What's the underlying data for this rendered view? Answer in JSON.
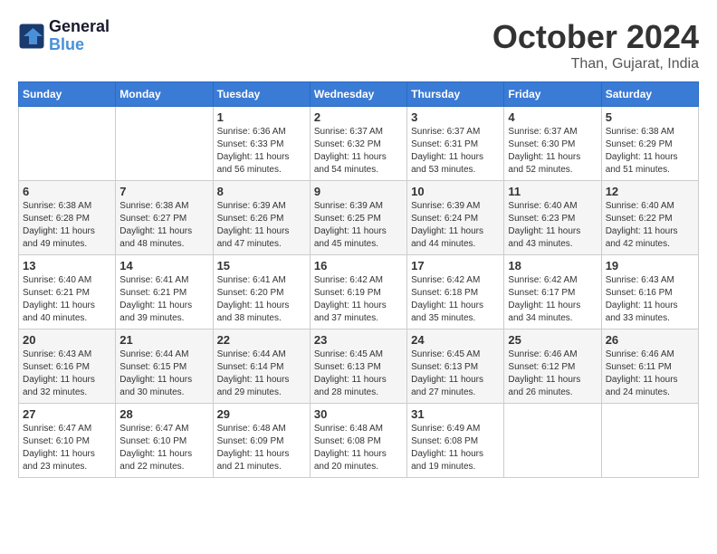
{
  "logo": {
    "line1": "General",
    "line2": "Blue"
  },
  "title": "October 2024",
  "location": "Than, Gujarat, India",
  "days_header": [
    "Sunday",
    "Monday",
    "Tuesday",
    "Wednesday",
    "Thursday",
    "Friday",
    "Saturday"
  ],
  "weeks": [
    [
      {
        "day": "",
        "sunrise": "",
        "sunset": "",
        "daylight": ""
      },
      {
        "day": "",
        "sunrise": "",
        "sunset": "",
        "daylight": ""
      },
      {
        "day": "1",
        "sunrise": "Sunrise: 6:36 AM",
        "sunset": "Sunset: 6:33 PM",
        "daylight": "Daylight: 11 hours and 56 minutes."
      },
      {
        "day": "2",
        "sunrise": "Sunrise: 6:37 AM",
        "sunset": "Sunset: 6:32 PM",
        "daylight": "Daylight: 11 hours and 54 minutes."
      },
      {
        "day": "3",
        "sunrise": "Sunrise: 6:37 AM",
        "sunset": "Sunset: 6:31 PM",
        "daylight": "Daylight: 11 hours and 53 minutes."
      },
      {
        "day": "4",
        "sunrise": "Sunrise: 6:37 AM",
        "sunset": "Sunset: 6:30 PM",
        "daylight": "Daylight: 11 hours and 52 minutes."
      },
      {
        "day": "5",
        "sunrise": "Sunrise: 6:38 AM",
        "sunset": "Sunset: 6:29 PM",
        "daylight": "Daylight: 11 hours and 51 minutes."
      }
    ],
    [
      {
        "day": "6",
        "sunrise": "Sunrise: 6:38 AM",
        "sunset": "Sunset: 6:28 PM",
        "daylight": "Daylight: 11 hours and 49 minutes."
      },
      {
        "day": "7",
        "sunrise": "Sunrise: 6:38 AM",
        "sunset": "Sunset: 6:27 PM",
        "daylight": "Daylight: 11 hours and 48 minutes."
      },
      {
        "day": "8",
        "sunrise": "Sunrise: 6:39 AM",
        "sunset": "Sunset: 6:26 PM",
        "daylight": "Daylight: 11 hours and 47 minutes."
      },
      {
        "day": "9",
        "sunrise": "Sunrise: 6:39 AM",
        "sunset": "Sunset: 6:25 PM",
        "daylight": "Daylight: 11 hours and 45 minutes."
      },
      {
        "day": "10",
        "sunrise": "Sunrise: 6:39 AM",
        "sunset": "Sunset: 6:24 PM",
        "daylight": "Daylight: 11 hours and 44 minutes."
      },
      {
        "day": "11",
        "sunrise": "Sunrise: 6:40 AM",
        "sunset": "Sunset: 6:23 PM",
        "daylight": "Daylight: 11 hours and 43 minutes."
      },
      {
        "day": "12",
        "sunrise": "Sunrise: 6:40 AM",
        "sunset": "Sunset: 6:22 PM",
        "daylight": "Daylight: 11 hours and 42 minutes."
      }
    ],
    [
      {
        "day": "13",
        "sunrise": "Sunrise: 6:40 AM",
        "sunset": "Sunset: 6:21 PM",
        "daylight": "Daylight: 11 hours and 40 minutes."
      },
      {
        "day": "14",
        "sunrise": "Sunrise: 6:41 AM",
        "sunset": "Sunset: 6:21 PM",
        "daylight": "Daylight: 11 hours and 39 minutes."
      },
      {
        "day": "15",
        "sunrise": "Sunrise: 6:41 AM",
        "sunset": "Sunset: 6:20 PM",
        "daylight": "Daylight: 11 hours and 38 minutes."
      },
      {
        "day": "16",
        "sunrise": "Sunrise: 6:42 AM",
        "sunset": "Sunset: 6:19 PM",
        "daylight": "Daylight: 11 hours and 37 minutes."
      },
      {
        "day": "17",
        "sunrise": "Sunrise: 6:42 AM",
        "sunset": "Sunset: 6:18 PM",
        "daylight": "Daylight: 11 hours and 35 minutes."
      },
      {
        "day": "18",
        "sunrise": "Sunrise: 6:42 AM",
        "sunset": "Sunset: 6:17 PM",
        "daylight": "Daylight: 11 hours and 34 minutes."
      },
      {
        "day": "19",
        "sunrise": "Sunrise: 6:43 AM",
        "sunset": "Sunset: 6:16 PM",
        "daylight": "Daylight: 11 hours and 33 minutes."
      }
    ],
    [
      {
        "day": "20",
        "sunrise": "Sunrise: 6:43 AM",
        "sunset": "Sunset: 6:16 PM",
        "daylight": "Daylight: 11 hours and 32 minutes."
      },
      {
        "day": "21",
        "sunrise": "Sunrise: 6:44 AM",
        "sunset": "Sunset: 6:15 PM",
        "daylight": "Daylight: 11 hours and 30 minutes."
      },
      {
        "day": "22",
        "sunrise": "Sunrise: 6:44 AM",
        "sunset": "Sunset: 6:14 PM",
        "daylight": "Daylight: 11 hours and 29 minutes."
      },
      {
        "day": "23",
        "sunrise": "Sunrise: 6:45 AM",
        "sunset": "Sunset: 6:13 PM",
        "daylight": "Daylight: 11 hours and 28 minutes."
      },
      {
        "day": "24",
        "sunrise": "Sunrise: 6:45 AM",
        "sunset": "Sunset: 6:13 PM",
        "daylight": "Daylight: 11 hours and 27 minutes."
      },
      {
        "day": "25",
        "sunrise": "Sunrise: 6:46 AM",
        "sunset": "Sunset: 6:12 PM",
        "daylight": "Daylight: 11 hours and 26 minutes."
      },
      {
        "day": "26",
        "sunrise": "Sunrise: 6:46 AM",
        "sunset": "Sunset: 6:11 PM",
        "daylight": "Daylight: 11 hours and 24 minutes."
      }
    ],
    [
      {
        "day": "27",
        "sunrise": "Sunrise: 6:47 AM",
        "sunset": "Sunset: 6:10 PM",
        "daylight": "Daylight: 11 hours and 23 minutes."
      },
      {
        "day": "28",
        "sunrise": "Sunrise: 6:47 AM",
        "sunset": "Sunset: 6:10 PM",
        "daylight": "Daylight: 11 hours and 22 minutes."
      },
      {
        "day": "29",
        "sunrise": "Sunrise: 6:48 AM",
        "sunset": "Sunset: 6:09 PM",
        "daylight": "Daylight: 11 hours and 21 minutes."
      },
      {
        "day": "30",
        "sunrise": "Sunrise: 6:48 AM",
        "sunset": "Sunset: 6:08 PM",
        "daylight": "Daylight: 11 hours and 20 minutes."
      },
      {
        "day": "31",
        "sunrise": "Sunrise: 6:49 AM",
        "sunset": "Sunset: 6:08 PM",
        "daylight": "Daylight: 11 hours and 19 minutes."
      },
      {
        "day": "",
        "sunrise": "",
        "sunset": "",
        "daylight": ""
      },
      {
        "day": "",
        "sunrise": "",
        "sunset": "",
        "daylight": ""
      }
    ]
  ]
}
